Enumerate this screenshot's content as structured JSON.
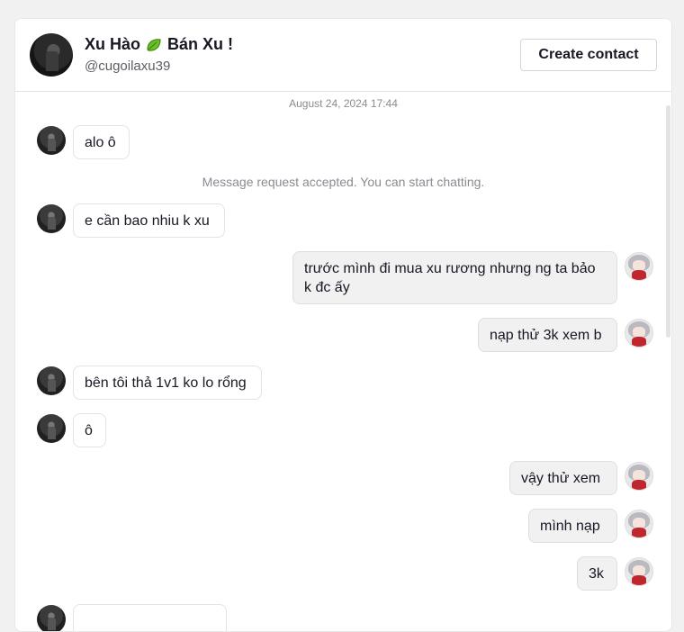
{
  "header": {
    "name": "Xu Hào",
    "name_suffix": "Bán Xu !",
    "emoji_icon": "leaf-emoji-icon",
    "handle": "@cugoilaxu39",
    "create_contact_label": "Create contact"
  },
  "conversation": {
    "timestamp": "August 24, 2024 17:44",
    "system_message": "Message request accepted. You can start chatting.",
    "messages": [
      {
        "from": "them",
        "text": "alo ô"
      },
      {
        "from": "them",
        "text": "e cần bao nhiu k xu"
      },
      {
        "from": "me",
        "text": "trước mình đi mua xu rương nhưng ng ta bảo k đc ấy"
      },
      {
        "from": "me",
        "text": "nạp thử 3k xem b"
      },
      {
        "from": "them",
        "text": "bên tôi thả 1v1 ko lo rổng"
      },
      {
        "from": "them",
        "text": "ô"
      },
      {
        "from": "me",
        "text": "vậy thử xem"
      },
      {
        "from": "me",
        "text": "mình nạp"
      },
      {
        "from": "me",
        "text": "3k"
      }
    ]
  },
  "colors": {
    "background": "#f1f1f2",
    "card": "#ffffff",
    "outgoing_bubble": "#f1f1f2",
    "text": "#161823",
    "muted": "#8a8b91"
  }
}
